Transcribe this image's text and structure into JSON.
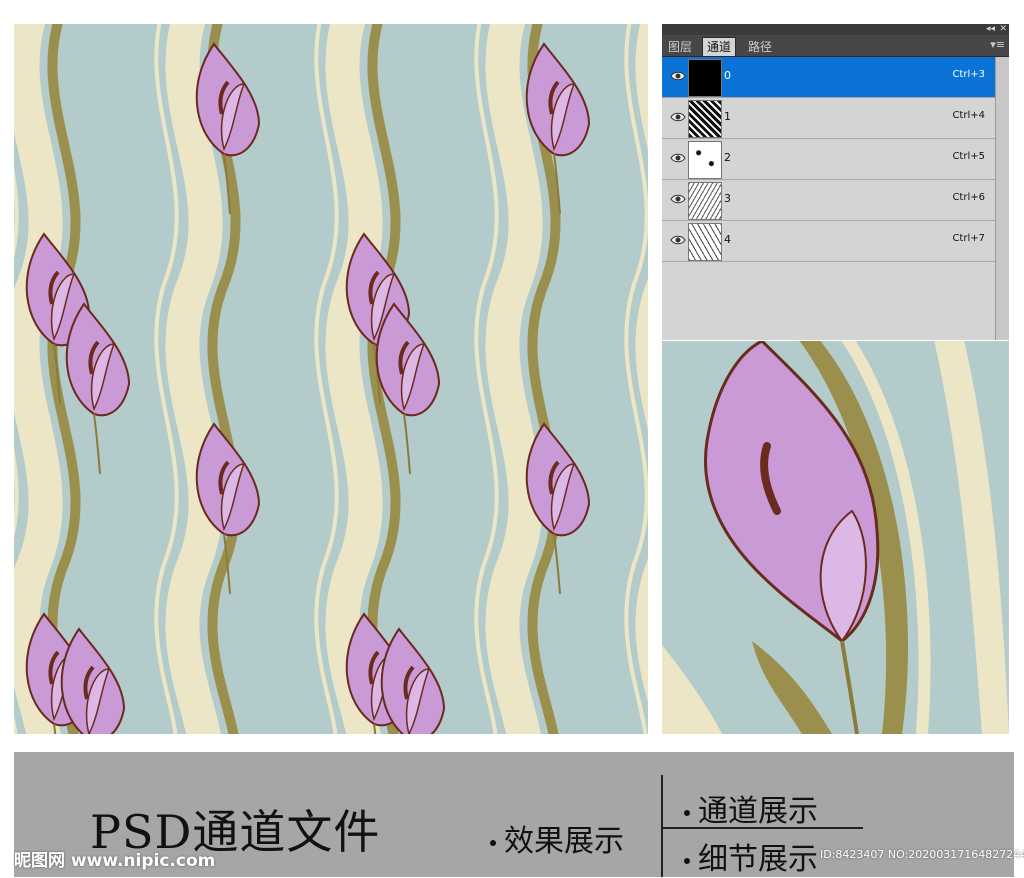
{
  "panel": {
    "topbar": {
      "collapse": "◂◂",
      "close": "✕"
    },
    "tabs": [
      "图层",
      "通道",
      "路径"
    ],
    "active_tab": "通道",
    "menu_icon": "▾≡",
    "channels": [
      {
        "name": "0",
        "shortcut": "Ctrl+3",
        "selected": true
      },
      {
        "name": "1",
        "shortcut": "Ctrl+4",
        "selected": false
      },
      {
        "name": "2",
        "shortcut": "Ctrl+5",
        "selected": false
      },
      {
        "name": "3",
        "shortcut": "Ctrl+6",
        "selected": false
      },
      {
        "name": "4",
        "shortcut": "Ctrl+7",
        "selected": false
      }
    ]
  },
  "footer": {
    "title": "PSD通道文件",
    "effect": "效果展示",
    "channel_show": "通道展示",
    "detail_show": "细节展示",
    "watermark_logo": "昵图网 www.nipic.com",
    "watermark_id": "ID:8423407 NO:20200317164827244087"
  },
  "colors": {
    "background": "#b3cccb",
    "cream": "#ece6c6",
    "olive": "#9b8f4e",
    "petal": "#c99ad6",
    "outline": "#6b2a1e",
    "selected": "#0b72d6",
    "footer_bar": "#a6a6a6"
  }
}
